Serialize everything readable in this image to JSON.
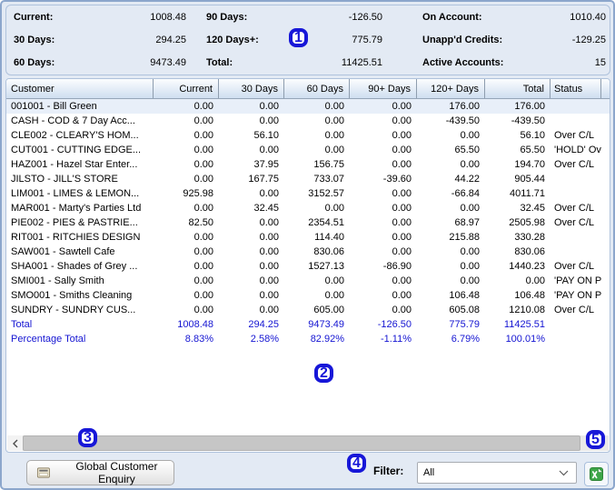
{
  "summary": {
    "col1": [
      {
        "label": "Current:",
        "value": "1008.48"
      },
      {
        "label": "30 Days:",
        "value": "294.25"
      },
      {
        "label": "60 Days:",
        "value": "9473.49"
      }
    ],
    "col2": [
      {
        "label": "90 Days:",
        "value": "-126.50"
      },
      {
        "label": "120 Days+:",
        "value": "775.79"
      },
      {
        "label": "Total:",
        "value": "11425.51"
      }
    ],
    "col3": [
      {
        "label": "On Account:",
        "value": "1010.40"
      },
      {
        "label": "Unapp'd Credits:",
        "value": "-129.25"
      },
      {
        "label": "Active Accounts:",
        "value": "15"
      }
    ]
  },
  "table": {
    "columns": [
      "Customer",
      "Current",
      "30 Days",
      "60 Days",
      "90+ Days",
      "120+ Days",
      "Total",
      "Status"
    ],
    "selected_index": 0,
    "rows": [
      [
        "001001 - Bill Green",
        "0.00",
        "0.00",
        "0.00",
        "0.00",
        "176.00",
        "176.00",
        ""
      ],
      [
        "CASH   - COD & 7 Day Acc...",
        "0.00",
        "0.00",
        "0.00",
        "0.00",
        "-439.50",
        "-439.50",
        ""
      ],
      [
        "CLE002 - CLEARY'S HOM...",
        "0.00",
        "56.10",
        "0.00",
        "0.00",
        "0.00",
        "56.10",
        "Over C/L"
      ],
      [
        "CUT001 - CUTTING EDGE...",
        "0.00",
        "0.00",
        "0.00",
        "0.00",
        "65.50",
        "65.50",
        "'HOLD' Over"
      ],
      [
        "HAZ001 - Hazel Star Enter...",
        "0.00",
        "37.95",
        "156.75",
        "0.00",
        "0.00",
        "194.70",
        "Over C/L"
      ],
      [
        "JILSTO - JILL'S STORE",
        "0.00",
        "167.75",
        "733.07",
        "-39.60",
        "44.22",
        "905.44",
        ""
      ],
      [
        "LIM001 - LIMES & LEMON...",
        "925.98",
        "0.00",
        "3152.57",
        "0.00",
        "-66.84",
        "4011.71",
        ""
      ],
      [
        "MAR001 - Marty's Parties Ltd",
        "0.00",
        "32.45",
        "0.00",
        "0.00",
        "0.00",
        "32.45",
        "Over C/L"
      ],
      [
        "PIE002 - PIES & PASTRIE...",
        "82.50",
        "0.00",
        "2354.51",
        "0.00",
        "68.97",
        "2505.98",
        "Over C/L"
      ],
      [
        "RIT001 - RITCHIES DESIGN",
        "0.00",
        "0.00",
        "114.40",
        "0.00",
        "215.88",
        "330.28",
        ""
      ],
      [
        "SAW001 - Sawtell Cafe",
        "0.00",
        "0.00",
        "830.06",
        "0.00",
        "0.00",
        "830.06",
        ""
      ],
      [
        "SHA001 - Shades of Grey ...",
        "0.00",
        "0.00",
        "1527.13",
        "-86.90",
        "0.00",
        "1440.23",
        "Over C/L"
      ],
      [
        "SMI001 - Sally Smith",
        "0.00",
        "0.00",
        "0.00",
        "0.00",
        "0.00",
        "0.00",
        "'PAY ON PIC"
      ],
      [
        "SMO001 - Smiths Cleaning",
        "0.00",
        "0.00",
        "0.00",
        "0.00",
        "106.48",
        "106.48",
        "'PAY ON PIC"
      ],
      [
        "SUNDRY - SUNDRY CUS...",
        "0.00",
        "0.00",
        "605.00",
        "0.00",
        "605.08",
        "1210.08",
        "Over C/L"
      ]
    ],
    "total_row": [
      "Total",
      "1008.48",
      "294.25",
      "9473.49",
      "-126.50",
      "775.79",
      "11425.51",
      ""
    ],
    "percentage_row": [
      "Percentage Total",
      "8.83%",
      "2.58%",
      "82.92%",
      "-1.11%",
      "6.79%",
      "100.01%",
      ""
    ]
  },
  "badges": [
    {
      "label": "1"
    },
    {
      "label": "2"
    },
    {
      "label": "3"
    },
    {
      "label": "4"
    },
    {
      "label": "5"
    }
  ],
  "footer": {
    "enquiry_button_label": "Global Customer Enquiry",
    "filter_label": "Filter:",
    "filter_value": "All"
  },
  "icons": {
    "enquiry_icon": "cash-register-icon",
    "excel_icon": "excel-export-icon",
    "dropdown_icon": "chevron-down-icon",
    "scroll_left_icon": "chevron-left-icon"
  },
  "colors": {
    "accent_blue": "#1717D8",
    "totals_text": "#1414D2",
    "window_background": "#E3EAF4",
    "header_gradient_bottom": "#CFDEF0",
    "excel_green": "#3DA648"
  }
}
